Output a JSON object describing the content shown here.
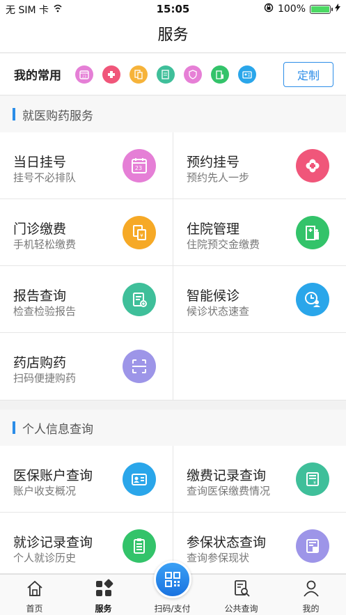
{
  "status_bar": {
    "carrier": "无 SIM 卡",
    "time": "15:05",
    "battery": "100%"
  },
  "nav": {
    "title": "服务"
  },
  "common": {
    "label": "我的常用",
    "custom_button": "定制",
    "icons": [
      {
        "name": "calendar-icon",
        "color": "#e57fd6"
      },
      {
        "name": "cross-icon",
        "color": "#f0567a"
      },
      {
        "name": "bill-icon",
        "color": "#f6b33a"
      },
      {
        "name": "report-icon",
        "color": "#3fbf9a"
      },
      {
        "name": "shield-icon",
        "color": "#e67fd6"
      },
      {
        "name": "hospital-icon",
        "color": "#33c36a"
      },
      {
        "name": "card-icon",
        "color": "#2aa6ea"
      }
    ]
  },
  "section1": {
    "title": "就医购药服务",
    "items": [
      {
        "title": "当日挂号",
        "sub": "挂号不必排队",
        "icon": "calendar-icon",
        "color": "#e57fd6"
      },
      {
        "title": "预约挂号",
        "sub": "预约先人一步",
        "icon": "cross-icon",
        "color": "#f0567a"
      },
      {
        "title": "门诊缴费",
        "sub": "手机轻松缴费",
        "icon": "bill-icon",
        "color": "#f6a926"
      },
      {
        "title": "住院管理",
        "sub": "住院预交金缴费",
        "icon": "hospital-icon",
        "color": "#33c36a"
      },
      {
        "title": "报告查询",
        "sub": "检查检验报告",
        "icon": "report-icon",
        "color": "#3fbf9a"
      },
      {
        "title": "智能候诊",
        "sub": "候诊状态速查",
        "icon": "clock-user-icon",
        "color": "#2aa6ea"
      },
      {
        "title": "药店购药",
        "sub": "扫码便捷购药",
        "icon": "scan-icon",
        "color": "#9d95e8"
      }
    ]
  },
  "section2": {
    "title": "个人信息查询",
    "items": [
      {
        "title": "医保账户查询",
        "sub": "账户收支概况",
        "icon": "id-card-icon",
        "color": "#2aa6ea"
      },
      {
        "title": "缴费记录查询",
        "sub": "查询医保缴费情况",
        "icon": "receipt-icon",
        "color": "#3fbf9a"
      },
      {
        "title": "就诊记录查询",
        "sub": "个人就诊历史",
        "icon": "clipboard-icon",
        "color": "#33c36a"
      },
      {
        "title": "参保状态查询",
        "sub": "查询参保现状",
        "icon": "insurance-doc-icon",
        "color": "#9d95e8"
      }
    ]
  },
  "tabs": [
    {
      "label": "首页",
      "icon": "home-icon"
    },
    {
      "label": "服务",
      "icon": "grid-icon"
    },
    {
      "label": "扫码/支付",
      "icon": "qr-icon"
    },
    {
      "label": "公共查询",
      "icon": "search-doc-icon"
    },
    {
      "label": "我的",
      "icon": "user-icon"
    }
  ]
}
